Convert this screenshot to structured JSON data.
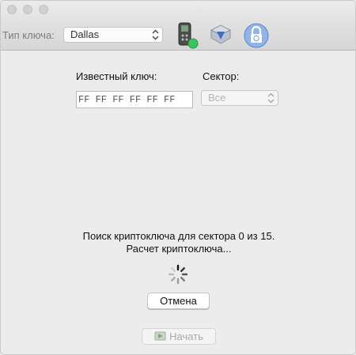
{
  "toolbar": {
    "key_type_label": "Тип ключа:",
    "key_type_value": "Dallas",
    "icons": [
      "device-reader-icon",
      "import-arrow-icon",
      "lock-icon"
    ]
  },
  "form": {
    "known_key_label": "Известный ключ:",
    "known_key_value": "FF FF FF FF FF FF",
    "sector_label": "Сектор:",
    "sector_value": "Все"
  },
  "status": {
    "line1": "Поиск криптоключа для сектора 0 из 15.",
    "line2": "Расчет криптоключа..."
  },
  "buttons": {
    "cancel": "Отмена",
    "start": "Начать"
  }
}
